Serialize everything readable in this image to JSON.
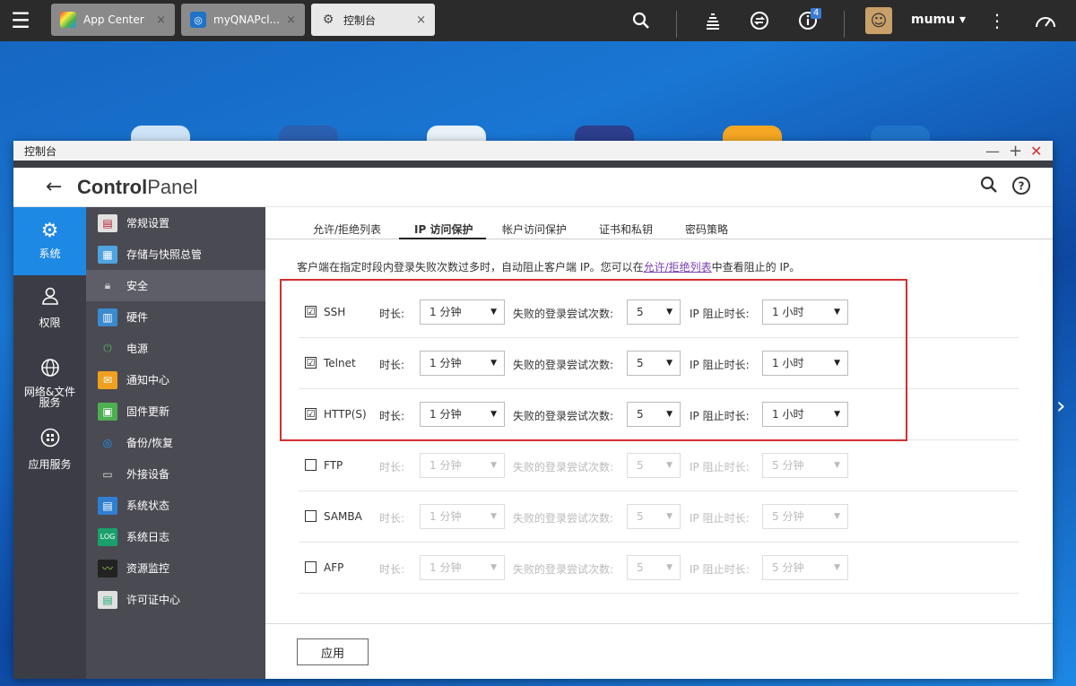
{
  "topbar": {
    "tabs": [
      {
        "label": "App Center",
        "close": "×"
      },
      {
        "label": "myQNAPcl...",
        "close": "×"
      },
      {
        "label": "控制台",
        "close": "×"
      }
    ],
    "notification_count": "4",
    "username": "mumu ▾"
  },
  "window": {
    "title": "控制台",
    "header_bold": "Control",
    "header_light": "Panel"
  },
  "rail": {
    "items": [
      {
        "label": "系统"
      },
      {
        "label": "权限"
      },
      {
        "label": "网络&文件服务"
      },
      {
        "label": "应用服务"
      }
    ]
  },
  "submenu": {
    "items": [
      {
        "label": "常规设置"
      },
      {
        "label": "存储与快照总管"
      },
      {
        "label": "安全"
      },
      {
        "label": "硬件"
      },
      {
        "label": "电源"
      },
      {
        "label": "通知中心"
      },
      {
        "label": "固件更新"
      },
      {
        "label": "备份/恢复"
      },
      {
        "label": "外接设备"
      },
      {
        "label": "系统状态"
      },
      {
        "label": "系统日志"
      },
      {
        "label": "资源监控"
      },
      {
        "label": "许可证中心"
      }
    ]
  },
  "content": {
    "tabs": [
      {
        "label": "允许/拒绝列表"
      },
      {
        "label": "IP 访问保护"
      },
      {
        "label": "帐户访问保护"
      },
      {
        "label": "证书和私钥"
      },
      {
        "label": "密码策略"
      }
    ],
    "desc_pre": "客户端在指定时段内登录失败次数过多时，自动阻止客户端 IP。您可以在",
    "desc_link": "允许/拒绝列表",
    "desc_post": "中查看阻止的 IP。",
    "labels": {
      "duration": "时长:",
      "attempts": "失败的登录尝试次数:",
      "block": "IP 阻止时长:"
    },
    "rows": [
      {
        "service": "SSH",
        "checked": "☑",
        "duration": "1 分钟",
        "attempts": "5",
        "block": "1 小时"
      },
      {
        "service": "Telnet",
        "checked": "☑",
        "duration": "1 分钟",
        "attempts": "5",
        "block": "1 小时"
      },
      {
        "service": "HTTP(S)",
        "checked": "☑",
        "duration": "1 分钟",
        "attempts": "5",
        "block": "1 小时"
      },
      {
        "service": "FTP",
        "checked": "",
        "duration": "1 分钟",
        "attempts": "5",
        "block": "5 分钟"
      },
      {
        "service": "SAMBA",
        "checked": "",
        "duration": "1 分钟",
        "attempts": "5",
        "block": "5 分钟"
      },
      {
        "service": "AFP",
        "checked": "",
        "duration": "1 分钟",
        "attempts": "5",
        "block": "5 分钟"
      }
    ],
    "apply_label": "应用"
  },
  "colors": {
    "accent": "#1e88e5",
    "rail_bg": "#3c3c46",
    "submenu_bg": "#4a4a53",
    "highlight": "#d32f2f"
  }
}
